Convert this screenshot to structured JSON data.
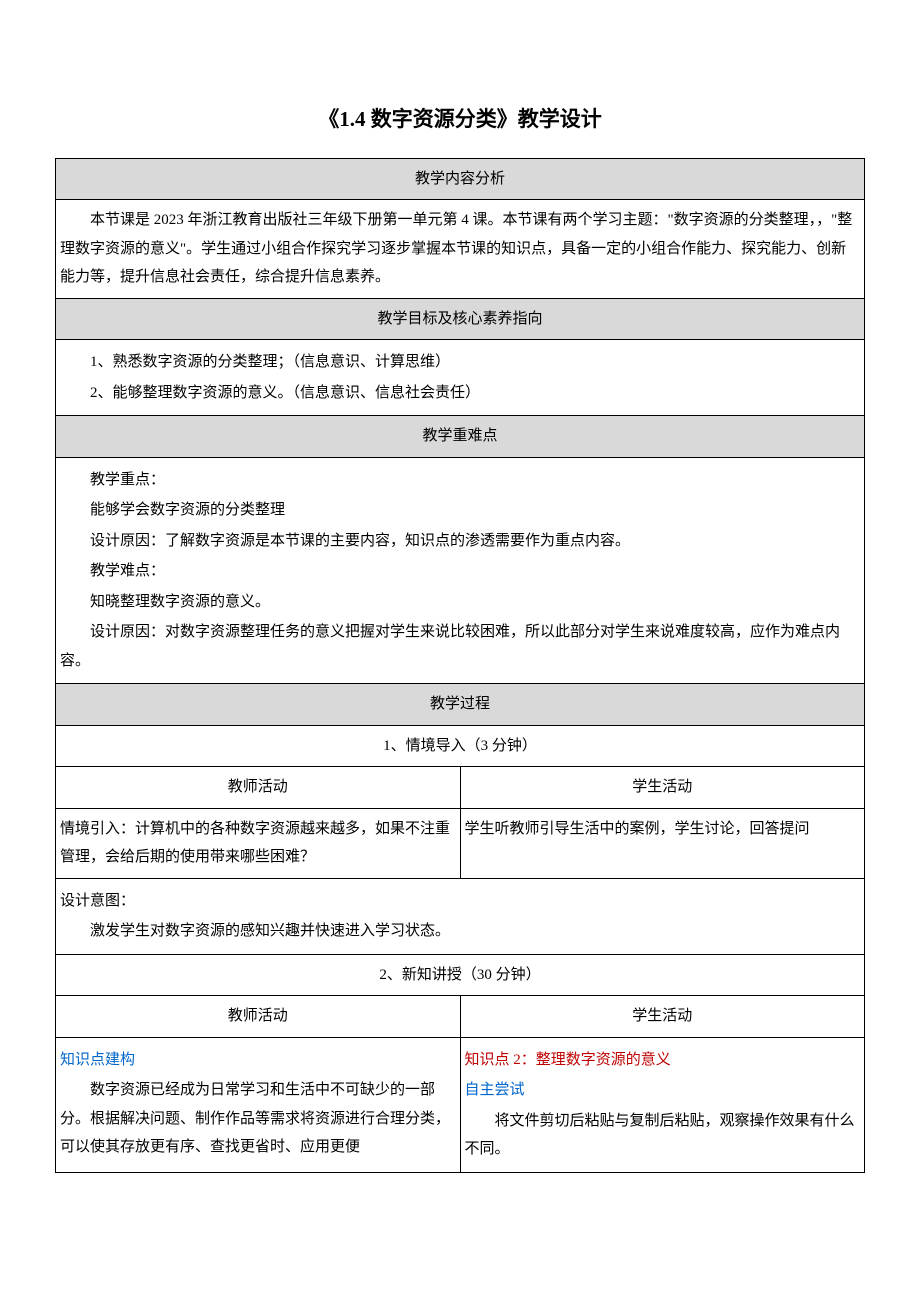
{
  "title": "《1.4 数字资源分类》教学设计",
  "sections": {
    "analysis": {
      "header": "教学内容分析",
      "body": "本节课是 2023 年浙江教育出版社三年级下册第一单元第 4 课。本节课有两个学习主题：\"数字资源的分类整理，，\"整理数字资源的意义\"。学生通过小组合作探究学习逐步掌握本节课的知识点，具备一定的小组合作能力、探究能力、创新能力等，提升信息社会责任，综合提升信息素养。"
    },
    "goals": {
      "header": "教学目标及核心素养指向",
      "items": [
        "1、熟悉数字资源的分类整理；（信息意识、计算思维）",
        "2、能够整理数字资源的意义。（信息意识、信息社会责任）"
      ]
    },
    "keypoints": {
      "header": "教学重难点",
      "focus_label": "教学重点：",
      "focus_text": "能够学会数字资源的分类整理",
      "focus_reason": "设计原因：了解数字资源是本节课的主要内容，知识点的渗透需要作为重点内容。",
      "difficulty_label": "教学难点：",
      "difficulty_text": "知晓整理数字资源的意义。",
      "difficulty_reason": "设计原因：对数字资源整理任务的意义把握对学生来说比较困难，所以此部分对学生来说难度较高，应作为难点内容。"
    },
    "process": {
      "header": "教学过程",
      "step1": {
        "title": "1、情境导入（3 分钟）",
        "teacher_header": "教师活动",
        "student_header": "学生活动",
        "teacher_text": "情境引入：计算机中的各种数字资源越来越多，如果不注重管理，会给后期的使用带来哪些困难？",
        "student_text": "学生听教师引导生活中的案例，学生讨论，回答提问",
        "design_label": "设计意图：",
        "design_text": "激发学生对数字资源的感知兴趣并快速进入学习状态。"
      },
      "step2": {
        "title": "2、新知讲授（30 分钟）",
        "teacher_header": "教师活动",
        "student_header": "学生活动",
        "teacher_k_label": "知识点建构",
        "teacher_k_text": "数字资源已经成为日常学习和生活中不可缺少的一部分。根据解决问题、制作作品等需求将资源进行合理分类，可以使其存放更有序、查找更省时、应用更便",
        "student_k_label": "知识点 2：整理数字资源的意义",
        "student_try_label": "自主尝试",
        "student_try_text": "将文件剪切后粘贴与复制后粘贴，观察操作效果有什么不同。"
      }
    }
  }
}
